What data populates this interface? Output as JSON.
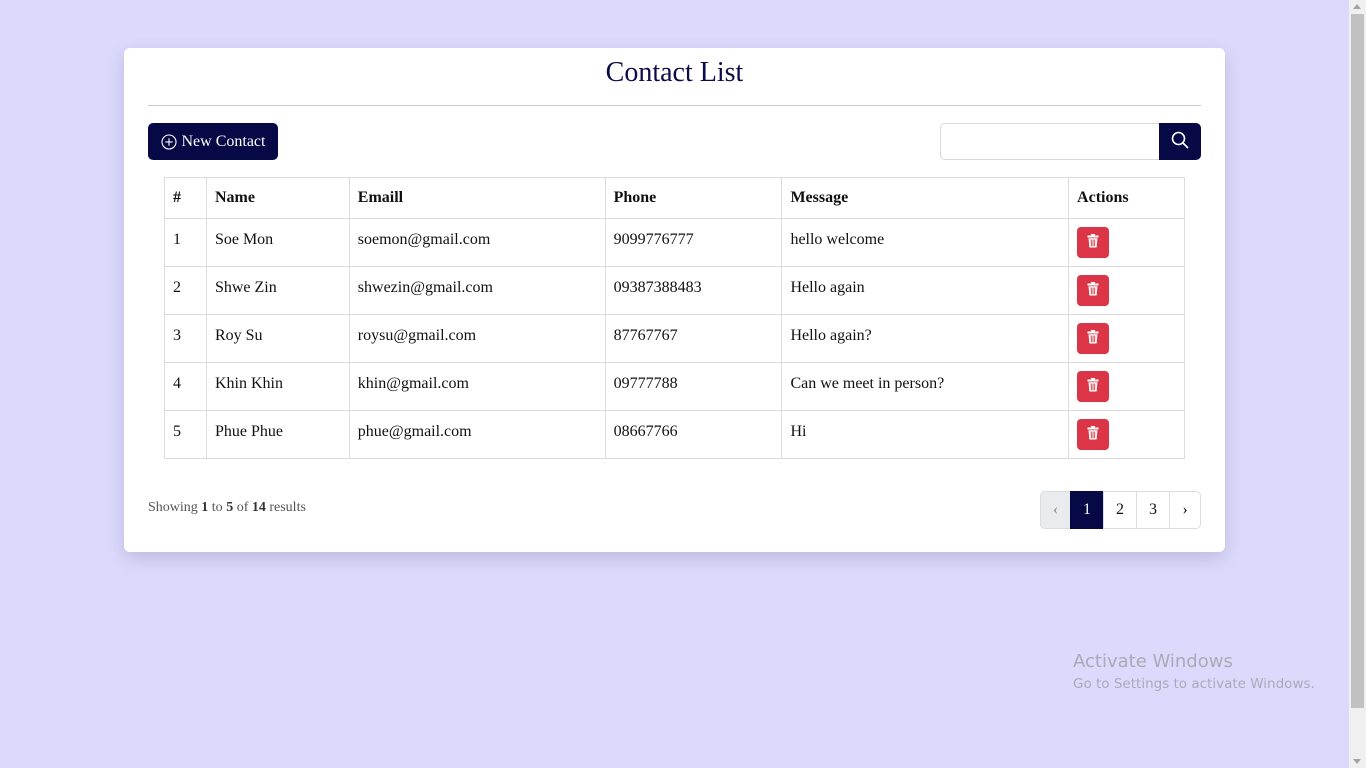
{
  "header": {
    "title": "Contact List"
  },
  "toolbar": {
    "new_contact_label": "New Contact",
    "new_contact_icon": "plus-circle-icon",
    "search_placeholder": "",
    "search_icon": "search-icon"
  },
  "table": {
    "columns": [
      "#",
      "Name",
      "Emaill",
      "Phone",
      "Message",
      "Actions"
    ],
    "rows": [
      {
        "num": "1",
        "name": "Soe Mon",
        "email": "soemon@gmail.com",
        "phone": "9099776777",
        "message": "hello welcome"
      },
      {
        "num": "2",
        "name": "Shwe Zin",
        "email": "shwezin@gmail.com",
        "phone": "09387388483",
        "message": "Hello again"
      },
      {
        "num": "3",
        "name": "Roy Su",
        "email": "roysu@gmail.com",
        "phone": "87767767",
        "message": "Hello again?"
      },
      {
        "num": "4",
        "name": "Khin Khin",
        "email": "khin@gmail.com",
        "phone": "09777788",
        "message": "Can we meet in person?"
      },
      {
        "num": "5",
        "name": "Phue Phue",
        "email": "phue@gmail.com",
        "phone": "08667766",
        "message": "Hi"
      }
    ],
    "delete_icon": "trash-icon"
  },
  "summary": {
    "prefix": "Showing",
    "from": "1",
    "to_word": "to",
    "to": "5",
    "of_word": "of",
    "total": "14",
    "suffix": "results"
  },
  "pagination": {
    "prev": "‹",
    "pages": [
      "1",
      "2",
      "3"
    ],
    "active": "1",
    "next": "›"
  },
  "watermark": {
    "line1": "Activate Windows",
    "line2": "Go to Settings to activate Windows."
  },
  "colors": {
    "page_bg": "#dcdafc",
    "primary": "#070846",
    "danger": "#dc3545",
    "title": "#0b0b4a"
  }
}
